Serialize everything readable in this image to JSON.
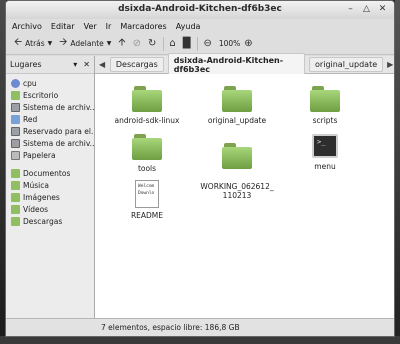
{
  "window": {
    "title": "dsixda-Android-Kitchen-df6b3ec"
  },
  "menu": [
    "Archivo",
    "Editar",
    "Ver",
    "Ir",
    "Marcadores",
    "Ayuda"
  ],
  "toolbar": {
    "back": "Atrás",
    "forward": "Adelante",
    "zoom": "100%"
  },
  "sidebar": {
    "header": "Lugares",
    "items": [
      {
        "label": "cpu",
        "icon": "cpu-icon"
      },
      {
        "label": "Escritorio",
        "icon": "folder-icon"
      },
      {
        "label": "Sistema de archiv...",
        "icon": "drive-icon"
      },
      {
        "label": "Red",
        "icon": "network-icon"
      },
      {
        "label": "Reservado para el...",
        "icon": "drive-icon"
      },
      {
        "label": "Sistema de archiv...",
        "icon": "drive-icon"
      },
      {
        "label": "Papelera",
        "icon": "trash-icon"
      },
      {
        "label": "Documentos",
        "icon": "folder-icon"
      },
      {
        "label": "Música",
        "icon": "folder-icon"
      },
      {
        "label": "Imágenes",
        "icon": "folder-icon"
      },
      {
        "label": "Vídeos",
        "icon": "folder-icon"
      },
      {
        "label": "Descargas",
        "icon": "folder-icon"
      }
    ]
  },
  "pathbar": {
    "crumbs": [
      "Descargas",
      "dsixda-Android-Kitchen-df6b3ec",
      "original_update"
    ]
  },
  "files": [
    {
      "name": "android-sdk-linux",
      "type": "folder"
    },
    {
      "name": "original_update",
      "type": "folder"
    },
    {
      "name": "scripts",
      "type": "folder"
    },
    {
      "name": "tools",
      "type": "folder"
    },
    {
      "name": "WORKING_062612_\n110213",
      "type": "folder"
    },
    {
      "name": "menu",
      "type": "executable"
    },
    {
      "name": "README",
      "type": "text"
    }
  ],
  "readme_preview": [
    "Welcom",
    "Downlo"
  ],
  "status": "7 elementos, espacio libre: 186,8 GB",
  "colors": {
    "folder": "#8fbf62",
    "selection": "#a8c98b"
  }
}
